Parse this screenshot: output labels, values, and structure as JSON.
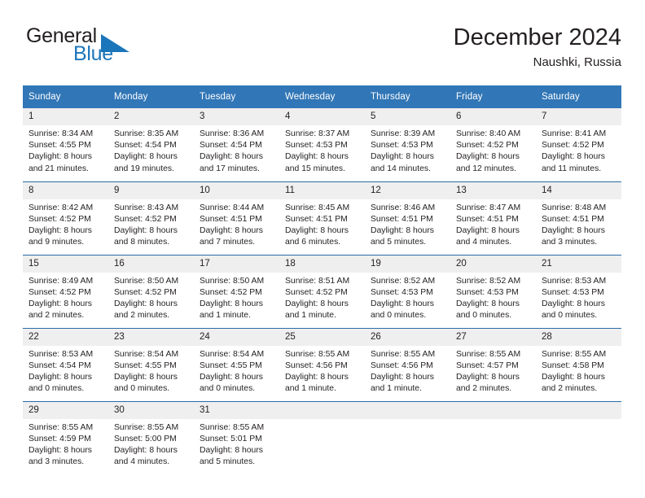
{
  "brand": {
    "name_part1": "General",
    "name_part2": "Blue",
    "flag_icon": "triangle-flag-icon",
    "accent_color": "#1b75bb"
  },
  "header": {
    "month_title": "December 2024",
    "location": "Naushki, Russia"
  },
  "theme": {
    "header_bg": "#3176b6",
    "header_text": "#ffffff",
    "daynum_bg": "#efefef",
    "row_divider": "#2b6ca8",
    "body_text": "#231f20"
  },
  "calendar": {
    "weekday_headers": [
      "Sunday",
      "Monday",
      "Tuesday",
      "Wednesday",
      "Thursday",
      "Friday",
      "Saturday"
    ],
    "weeks": [
      [
        {
          "day": "1",
          "sunrise": "Sunrise: 8:34 AM",
          "sunset": "Sunset: 4:55 PM",
          "daylight_line1": "Daylight: 8 hours",
          "daylight_line2": "and 21 minutes."
        },
        {
          "day": "2",
          "sunrise": "Sunrise: 8:35 AM",
          "sunset": "Sunset: 4:54 PM",
          "daylight_line1": "Daylight: 8 hours",
          "daylight_line2": "and 19 minutes."
        },
        {
          "day": "3",
          "sunrise": "Sunrise: 8:36 AM",
          "sunset": "Sunset: 4:54 PM",
          "daylight_line1": "Daylight: 8 hours",
          "daylight_line2": "and 17 minutes."
        },
        {
          "day": "4",
          "sunrise": "Sunrise: 8:37 AM",
          "sunset": "Sunset: 4:53 PM",
          "daylight_line1": "Daylight: 8 hours",
          "daylight_line2": "and 15 minutes."
        },
        {
          "day": "5",
          "sunrise": "Sunrise: 8:39 AM",
          "sunset": "Sunset: 4:53 PM",
          "daylight_line1": "Daylight: 8 hours",
          "daylight_line2": "and 14 minutes."
        },
        {
          "day": "6",
          "sunrise": "Sunrise: 8:40 AM",
          "sunset": "Sunset: 4:52 PM",
          "daylight_line1": "Daylight: 8 hours",
          "daylight_line2": "and 12 minutes."
        },
        {
          "day": "7",
          "sunrise": "Sunrise: 8:41 AM",
          "sunset": "Sunset: 4:52 PM",
          "daylight_line1": "Daylight: 8 hours",
          "daylight_line2": "and 11 minutes."
        }
      ],
      [
        {
          "day": "8",
          "sunrise": "Sunrise: 8:42 AM",
          "sunset": "Sunset: 4:52 PM",
          "daylight_line1": "Daylight: 8 hours",
          "daylight_line2": "and 9 minutes."
        },
        {
          "day": "9",
          "sunrise": "Sunrise: 8:43 AM",
          "sunset": "Sunset: 4:52 PM",
          "daylight_line1": "Daylight: 8 hours",
          "daylight_line2": "and 8 minutes."
        },
        {
          "day": "10",
          "sunrise": "Sunrise: 8:44 AM",
          "sunset": "Sunset: 4:51 PM",
          "daylight_line1": "Daylight: 8 hours",
          "daylight_line2": "and 7 minutes."
        },
        {
          "day": "11",
          "sunrise": "Sunrise: 8:45 AM",
          "sunset": "Sunset: 4:51 PM",
          "daylight_line1": "Daylight: 8 hours",
          "daylight_line2": "and 6 minutes."
        },
        {
          "day": "12",
          "sunrise": "Sunrise: 8:46 AM",
          "sunset": "Sunset: 4:51 PM",
          "daylight_line1": "Daylight: 8 hours",
          "daylight_line2": "and 5 minutes."
        },
        {
          "day": "13",
          "sunrise": "Sunrise: 8:47 AM",
          "sunset": "Sunset: 4:51 PM",
          "daylight_line1": "Daylight: 8 hours",
          "daylight_line2": "and 4 minutes."
        },
        {
          "day": "14",
          "sunrise": "Sunrise: 8:48 AM",
          "sunset": "Sunset: 4:51 PM",
          "daylight_line1": "Daylight: 8 hours",
          "daylight_line2": "and 3 minutes."
        }
      ],
      [
        {
          "day": "15",
          "sunrise": "Sunrise: 8:49 AM",
          "sunset": "Sunset: 4:52 PM",
          "daylight_line1": "Daylight: 8 hours",
          "daylight_line2": "and 2 minutes."
        },
        {
          "day": "16",
          "sunrise": "Sunrise: 8:50 AM",
          "sunset": "Sunset: 4:52 PM",
          "daylight_line1": "Daylight: 8 hours",
          "daylight_line2": "and 2 minutes."
        },
        {
          "day": "17",
          "sunrise": "Sunrise: 8:50 AM",
          "sunset": "Sunset: 4:52 PM",
          "daylight_line1": "Daylight: 8 hours",
          "daylight_line2": "and 1 minute."
        },
        {
          "day": "18",
          "sunrise": "Sunrise: 8:51 AM",
          "sunset": "Sunset: 4:52 PM",
          "daylight_line1": "Daylight: 8 hours",
          "daylight_line2": "and 1 minute."
        },
        {
          "day": "19",
          "sunrise": "Sunrise: 8:52 AM",
          "sunset": "Sunset: 4:53 PM",
          "daylight_line1": "Daylight: 8 hours",
          "daylight_line2": "and 0 minutes."
        },
        {
          "day": "20",
          "sunrise": "Sunrise: 8:52 AM",
          "sunset": "Sunset: 4:53 PM",
          "daylight_line1": "Daylight: 8 hours",
          "daylight_line2": "and 0 minutes."
        },
        {
          "day": "21",
          "sunrise": "Sunrise: 8:53 AM",
          "sunset": "Sunset: 4:53 PM",
          "daylight_line1": "Daylight: 8 hours",
          "daylight_line2": "and 0 minutes."
        }
      ],
      [
        {
          "day": "22",
          "sunrise": "Sunrise: 8:53 AM",
          "sunset": "Sunset: 4:54 PM",
          "daylight_line1": "Daylight: 8 hours",
          "daylight_line2": "and 0 minutes."
        },
        {
          "day": "23",
          "sunrise": "Sunrise: 8:54 AM",
          "sunset": "Sunset: 4:55 PM",
          "daylight_line1": "Daylight: 8 hours",
          "daylight_line2": "and 0 minutes."
        },
        {
          "day": "24",
          "sunrise": "Sunrise: 8:54 AM",
          "sunset": "Sunset: 4:55 PM",
          "daylight_line1": "Daylight: 8 hours",
          "daylight_line2": "and 0 minutes."
        },
        {
          "day": "25",
          "sunrise": "Sunrise: 8:55 AM",
          "sunset": "Sunset: 4:56 PM",
          "daylight_line1": "Daylight: 8 hours",
          "daylight_line2": "and 1 minute."
        },
        {
          "day": "26",
          "sunrise": "Sunrise: 8:55 AM",
          "sunset": "Sunset: 4:56 PM",
          "daylight_line1": "Daylight: 8 hours",
          "daylight_line2": "and 1 minute."
        },
        {
          "day": "27",
          "sunrise": "Sunrise: 8:55 AM",
          "sunset": "Sunset: 4:57 PM",
          "daylight_line1": "Daylight: 8 hours",
          "daylight_line2": "and 2 minutes."
        },
        {
          "day": "28",
          "sunrise": "Sunrise: 8:55 AM",
          "sunset": "Sunset: 4:58 PM",
          "daylight_line1": "Daylight: 8 hours",
          "daylight_line2": "and 2 minutes."
        }
      ],
      [
        {
          "day": "29",
          "sunrise": "Sunrise: 8:55 AM",
          "sunset": "Sunset: 4:59 PM",
          "daylight_line1": "Daylight: 8 hours",
          "daylight_line2": "and 3 minutes."
        },
        {
          "day": "30",
          "sunrise": "Sunrise: 8:55 AM",
          "sunset": "Sunset: 5:00 PM",
          "daylight_line1": "Daylight: 8 hours",
          "daylight_line2": "and 4 minutes."
        },
        {
          "day": "31",
          "sunrise": "Sunrise: 8:55 AM",
          "sunset": "Sunset: 5:01 PM",
          "daylight_line1": "Daylight: 8 hours",
          "daylight_line2": "and 5 minutes."
        },
        {
          "day": "",
          "sunrise": "",
          "sunset": "",
          "daylight_line1": "",
          "daylight_line2": ""
        },
        {
          "day": "",
          "sunrise": "",
          "sunset": "",
          "daylight_line1": "",
          "daylight_line2": ""
        },
        {
          "day": "",
          "sunrise": "",
          "sunset": "",
          "daylight_line1": "",
          "daylight_line2": ""
        },
        {
          "day": "",
          "sunrise": "",
          "sunset": "",
          "daylight_line1": "",
          "daylight_line2": ""
        }
      ]
    ]
  }
}
